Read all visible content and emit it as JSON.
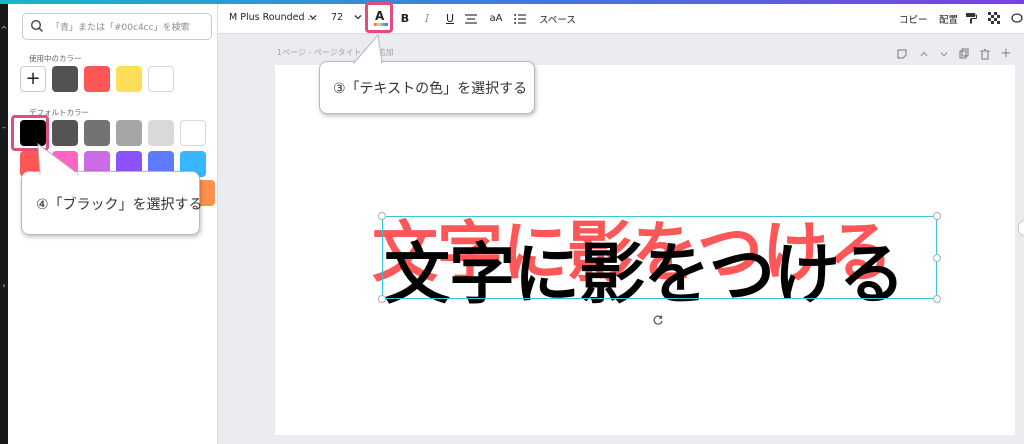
{
  "sidebar": {
    "search_placeholder": "「青」または「#00c4cc」を検索",
    "used_colors_label": "使用中のカラー",
    "default_colors_label": "デフォルトカラー",
    "used_colors": [
      "#525252",
      "#ff5757",
      "#ffde59",
      "#ffffff"
    ],
    "default_row1": [
      "#000000",
      "#545454",
      "#737373",
      "#a6a6a6",
      "#d9d9d9",
      "#ffffff"
    ],
    "default_row2": [
      "#ff5757",
      "#ff66c4",
      "#cb6ce6",
      "#8c52ff",
      "#5e7bff",
      "#38b6ff"
    ]
  },
  "toolbar": {
    "font_name": "M Plus Rounded ...",
    "font_size": "72",
    "bold": "B",
    "italic": "I",
    "underline": "U",
    "case": "aA",
    "spacing": "スペース",
    "copy": "コピー",
    "arrange": "配置",
    "text_color_letter": "A"
  },
  "page": {
    "header": "1ページ - ページタイトルを追加",
    "text": "文字に影をつける",
    "text_color": "#000000",
    "shadow_color": "#ff5757"
  },
  "callouts": {
    "step3": "③「テキストの色」を選択する",
    "step4": "④「ブラック」を選択する"
  },
  "colors": {
    "highlight": "#e14c83",
    "selection": "#36c7d8"
  }
}
